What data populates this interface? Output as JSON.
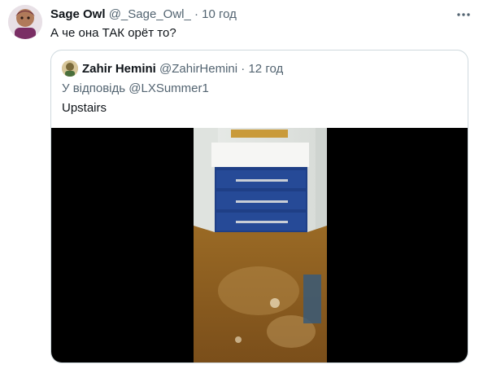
{
  "tweet": {
    "author_name": "Sage Owl",
    "author_handle": "@_Sage_Owl_",
    "separator": "·",
    "time": "10 год",
    "more_icon": "more-icon",
    "text": "А че она ТАК орёт то?"
  },
  "quoted_tweet": {
    "author_name": "Zahir Hemini",
    "author_handle": "@ZahirHemini",
    "separator": "·",
    "time": "12 год",
    "reply_to": "У відповідь @LXSummer1",
    "text": "Upstairs"
  },
  "colors": {
    "text_primary": "#0f1419",
    "text_secondary": "#536471",
    "border": "#cfd9de",
    "drawer_blue": "#1f3f86",
    "floor_brown": "#8a5a1e"
  }
}
